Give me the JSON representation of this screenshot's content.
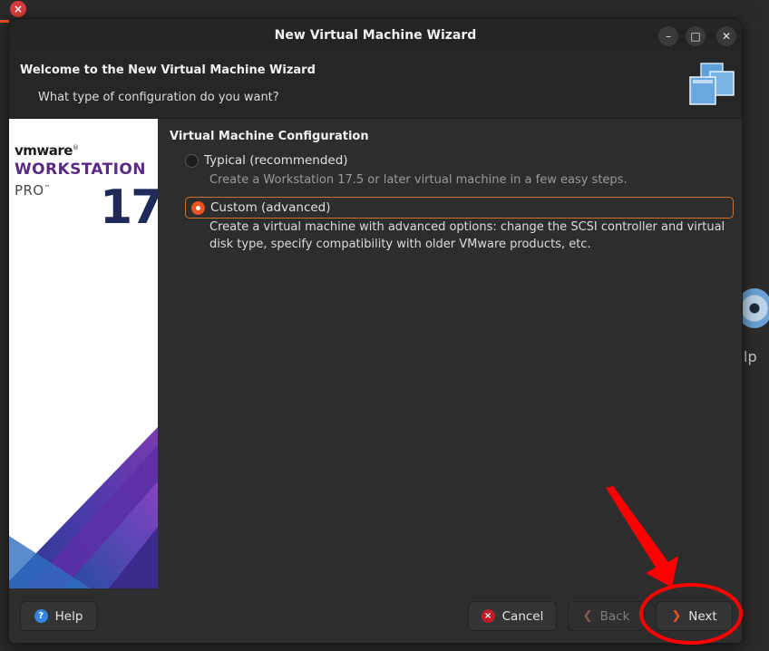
{
  "background": {
    "close_glyph": "×",
    "partial_text": "lp"
  },
  "window": {
    "title": "New Virtual Machine Wizard",
    "minimize_glyph": "–",
    "maximize_glyph": "□",
    "close_glyph": "✕"
  },
  "header": {
    "title": "Welcome to the New Virtual Machine Wizard",
    "subtitle": "What type of configuration do you want?",
    "icon": "virtual-machine-icon"
  },
  "banner": {
    "brand": "vmware",
    "brand_mark": "®",
    "product": "WORKSTATION",
    "edition": "PRO",
    "edition_mark": "™",
    "version": "17"
  },
  "config": {
    "section_title": "Virtual Machine Configuration",
    "selected": "custom",
    "options": [
      {
        "id": "typical",
        "label": "Typical (recommended)",
        "description": "Create a Workstation 17.5 or later virtual machine in a few easy steps."
      },
      {
        "id": "custom",
        "label": "Custom (advanced)",
        "description": "Create a virtual machine with advanced options: change the SCSI controller and virtual disk type, specify compatibility with older VMware products, etc."
      }
    ]
  },
  "footer": {
    "help_label": "Help",
    "cancel_label": "Cancel",
    "back_label": "Back",
    "next_label": "Next",
    "help_icon_glyph": "?",
    "cancel_icon_glyph": "×",
    "back_icon_glyph": "❮",
    "next_icon_glyph": "❯"
  },
  "colors": {
    "accent": "#e95420",
    "annotation": "#ff0000",
    "brand_purple": "#5b2a86"
  }
}
